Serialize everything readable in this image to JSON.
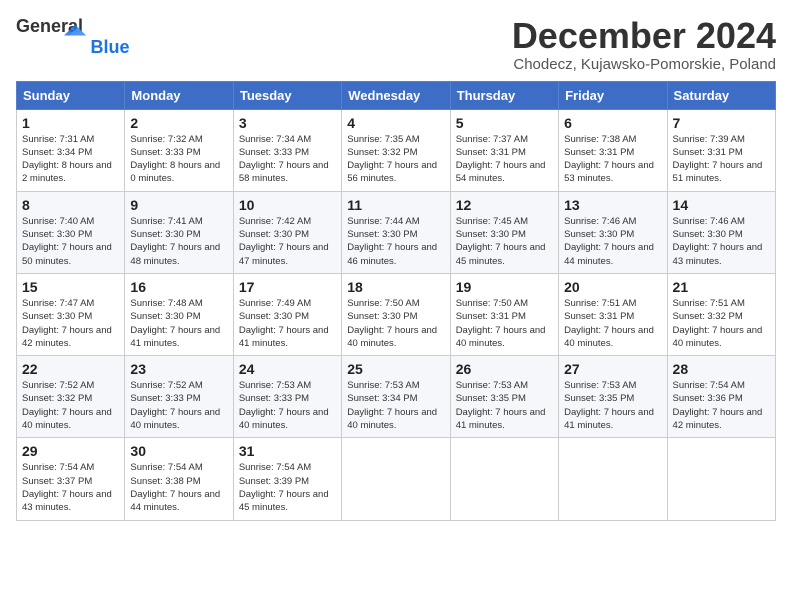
{
  "logo": {
    "general": "General",
    "blue": "Blue"
  },
  "header": {
    "month": "December 2024",
    "location": "Chodecz, Kujawsko-Pomorskie, Poland"
  },
  "weekdays": [
    "Sunday",
    "Monday",
    "Tuesday",
    "Wednesday",
    "Thursday",
    "Friday",
    "Saturday"
  ],
  "weeks": [
    [
      {
        "day": 1,
        "sunrise": "7:31 AM",
        "sunset": "3:34 PM",
        "daylight": "8 hours and 2 minutes."
      },
      {
        "day": 2,
        "sunrise": "7:32 AM",
        "sunset": "3:33 PM",
        "daylight": "8 hours and 0 minutes."
      },
      {
        "day": 3,
        "sunrise": "7:34 AM",
        "sunset": "3:33 PM",
        "daylight": "7 hours and 58 minutes."
      },
      {
        "day": 4,
        "sunrise": "7:35 AM",
        "sunset": "3:32 PM",
        "daylight": "7 hours and 56 minutes."
      },
      {
        "day": 5,
        "sunrise": "7:37 AM",
        "sunset": "3:31 PM",
        "daylight": "7 hours and 54 minutes."
      },
      {
        "day": 6,
        "sunrise": "7:38 AM",
        "sunset": "3:31 PM",
        "daylight": "7 hours and 53 minutes."
      },
      {
        "day": 7,
        "sunrise": "7:39 AM",
        "sunset": "3:31 PM",
        "daylight": "7 hours and 51 minutes."
      }
    ],
    [
      {
        "day": 8,
        "sunrise": "7:40 AM",
        "sunset": "3:30 PM",
        "daylight": "7 hours and 50 minutes."
      },
      {
        "day": 9,
        "sunrise": "7:41 AM",
        "sunset": "3:30 PM",
        "daylight": "7 hours and 48 minutes."
      },
      {
        "day": 10,
        "sunrise": "7:42 AM",
        "sunset": "3:30 PM",
        "daylight": "7 hours and 47 minutes."
      },
      {
        "day": 11,
        "sunrise": "7:44 AM",
        "sunset": "3:30 PM",
        "daylight": "7 hours and 46 minutes."
      },
      {
        "day": 12,
        "sunrise": "7:45 AM",
        "sunset": "3:30 PM",
        "daylight": "7 hours and 45 minutes."
      },
      {
        "day": 13,
        "sunrise": "7:46 AM",
        "sunset": "3:30 PM",
        "daylight": "7 hours and 44 minutes."
      },
      {
        "day": 14,
        "sunrise": "7:46 AM",
        "sunset": "3:30 PM",
        "daylight": "7 hours and 43 minutes."
      }
    ],
    [
      {
        "day": 15,
        "sunrise": "7:47 AM",
        "sunset": "3:30 PM",
        "daylight": "7 hours and 42 minutes."
      },
      {
        "day": 16,
        "sunrise": "7:48 AM",
        "sunset": "3:30 PM",
        "daylight": "7 hours and 41 minutes."
      },
      {
        "day": 17,
        "sunrise": "7:49 AM",
        "sunset": "3:30 PM",
        "daylight": "7 hours and 41 minutes."
      },
      {
        "day": 18,
        "sunrise": "7:50 AM",
        "sunset": "3:30 PM",
        "daylight": "7 hours and 40 minutes."
      },
      {
        "day": 19,
        "sunrise": "7:50 AM",
        "sunset": "3:31 PM",
        "daylight": "7 hours and 40 minutes."
      },
      {
        "day": 20,
        "sunrise": "7:51 AM",
        "sunset": "3:31 PM",
        "daylight": "7 hours and 40 minutes."
      },
      {
        "day": 21,
        "sunrise": "7:51 AM",
        "sunset": "3:32 PM",
        "daylight": "7 hours and 40 minutes."
      }
    ],
    [
      {
        "day": 22,
        "sunrise": "7:52 AM",
        "sunset": "3:32 PM",
        "daylight": "7 hours and 40 minutes."
      },
      {
        "day": 23,
        "sunrise": "7:52 AM",
        "sunset": "3:33 PM",
        "daylight": "7 hours and 40 minutes."
      },
      {
        "day": 24,
        "sunrise": "7:53 AM",
        "sunset": "3:33 PM",
        "daylight": "7 hours and 40 minutes."
      },
      {
        "day": 25,
        "sunrise": "7:53 AM",
        "sunset": "3:34 PM",
        "daylight": "7 hours and 40 minutes."
      },
      {
        "day": 26,
        "sunrise": "7:53 AM",
        "sunset": "3:35 PM",
        "daylight": "7 hours and 41 minutes."
      },
      {
        "day": 27,
        "sunrise": "7:53 AM",
        "sunset": "3:35 PM",
        "daylight": "7 hours and 41 minutes."
      },
      {
        "day": 28,
        "sunrise": "7:54 AM",
        "sunset": "3:36 PM",
        "daylight": "7 hours and 42 minutes."
      }
    ],
    [
      {
        "day": 29,
        "sunrise": "7:54 AM",
        "sunset": "3:37 PM",
        "daylight": "7 hours and 43 minutes."
      },
      {
        "day": 30,
        "sunrise": "7:54 AM",
        "sunset": "3:38 PM",
        "daylight": "7 hours and 44 minutes."
      },
      {
        "day": 31,
        "sunrise": "7:54 AM",
        "sunset": "3:39 PM",
        "daylight": "7 hours and 45 minutes."
      },
      null,
      null,
      null,
      null
    ]
  ]
}
